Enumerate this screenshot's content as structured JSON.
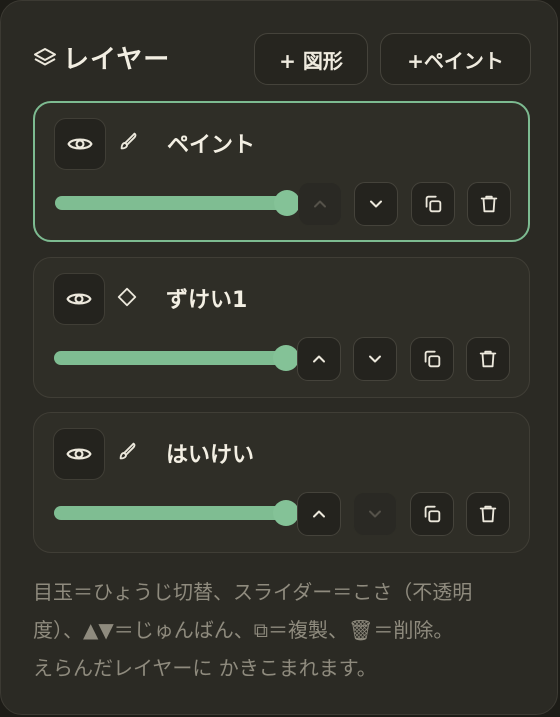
{
  "panel": {
    "title": "レイヤー",
    "add_shape_label": "+ 図形",
    "add_paint_label": "+ペイント"
  },
  "layers": [
    {
      "name": "ペイント",
      "type_icon": "brush-icon",
      "selected": true,
      "opacity": 1.0,
      "move_up_enabled": false,
      "move_down_enabled": true
    },
    {
      "name": "ずけい1",
      "type_icon": "diamond-icon",
      "selected": false,
      "opacity": 1.0,
      "move_up_enabled": true,
      "move_down_enabled": true
    },
    {
      "name": "はいけい",
      "type_icon": "brush-icon",
      "selected": false,
      "opacity": 1.0,
      "move_up_enabled": true,
      "move_down_enabled": false
    }
  ],
  "help_text": {
    "line1": "目玉＝ひょうじ切替、スライダー＝こさ（不透明",
    "line2": "度）、▲▼＝じゅんばん、⧉＝複製、🗑＝削除。",
    "line3": "えらんだレイヤーに かきこまれます。"
  },
  "colors": {
    "accent": "#7fbd92",
    "selected_border": "#7dbb91",
    "panel_bg": "#2b2a24",
    "card_bg": "#2f2e27",
    "help_text": "#8f8b7e"
  }
}
